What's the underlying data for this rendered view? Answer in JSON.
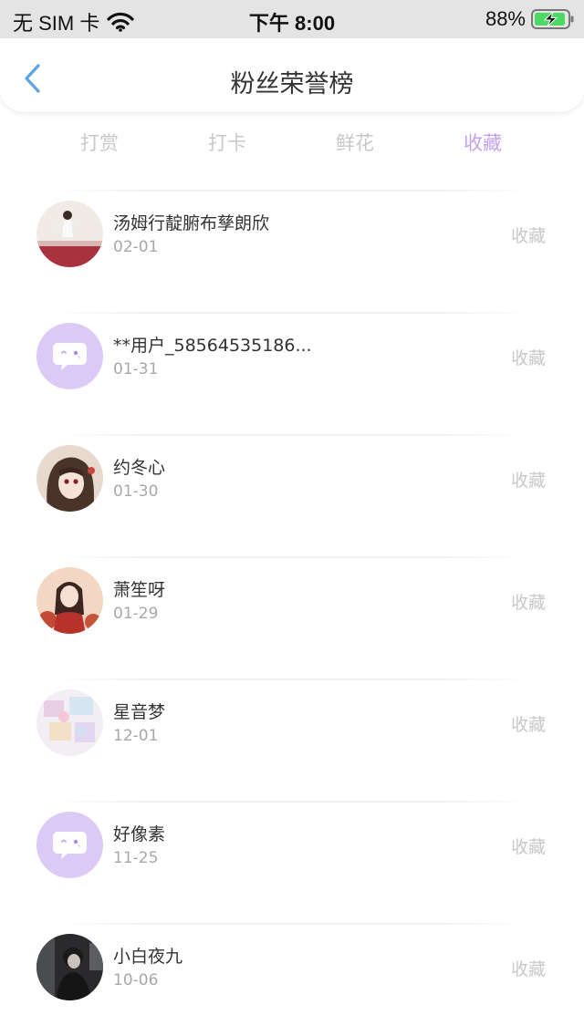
{
  "status_bar": {
    "carrier": "无 SIM 卡",
    "time": "下午 8:00",
    "battery": "88%"
  },
  "nav": {
    "title": "粉丝荣誉榜",
    "back_icon": "chevron-left-icon"
  },
  "tabs": [
    {
      "label": "打赏",
      "active": false
    },
    {
      "label": "打卡",
      "active": false
    },
    {
      "label": "鲜花",
      "active": false
    },
    {
      "label": "收藏",
      "active": true
    }
  ],
  "colors": {
    "accent": "#c3a3ee",
    "default_avatar_bg": "#dccaf6",
    "back_arrow": "#5aa4e6"
  },
  "fans": [
    {
      "name": "汤姆行靛腑布孳朗欣",
      "date": "02-01",
      "action": "收藏",
      "avatar": "photo-girl-white"
    },
    {
      "name": "**用户_58564535186...",
      "date": "01-31",
      "action": "收藏",
      "avatar": "default-chat-avatar"
    },
    {
      "name": "约冬心",
      "date": "01-30",
      "action": "收藏",
      "avatar": "anime-girl"
    },
    {
      "name": "萧笙呀",
      "date": "01-29",
      "action": "收藏",
      "avatar": "anime-girl-red"
    },
    {
      "name": "星音梦",
      "date": "12-01",
      "action": "收藏",
      "avatar": "pastel-pattern"
    },
    {
      "name": "好像素",
      "date": "11-25",
      "action": "收藏",
      "avatar": "default-chat-avatar"
    },
    {
      "name": "小白夜九",
      "date": "10-06",
      "action": "收藏",
      "avatar": "dark-photo"
    }
  ]
}
